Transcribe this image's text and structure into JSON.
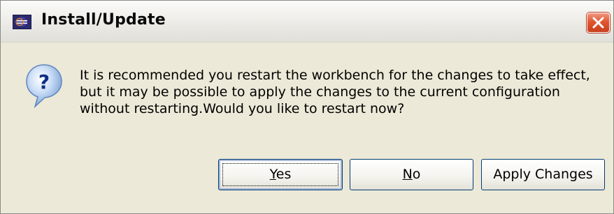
{
  "window": {
    "title": "Install/Update",
    "app_icon": "eclipse-icon",
    "close_icon": "close-icon"
  },
  "dialog": {
    "icon": "question-icon",
    "message": "It is recommended you restart the workbench for the changes to take effect,\nbut it may be possible to apply the changes to the current configuration\nwithout restarting.Would you like to restart now?"
  },
  "buttons": {
    "yes": {
      "mnemonic": "Y",
      "rest": "es"
    },
    "no": {
      "mnemonic": "N",
      "rest": "o"
    },
    "apply": {
      "label": "Apply Changes"
    }
  },
  "colors": {
    "dialog_bg": "#ece9d8",
    "button_border": "#003c74",
    "close_button": "#e0562f"
  }
}
